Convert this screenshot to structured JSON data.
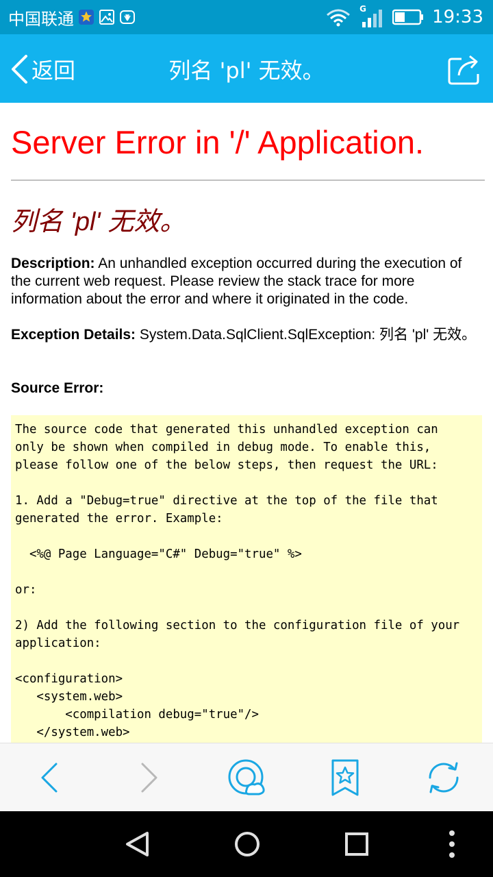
{
  "status_bar": {
    "carrier": "中国联通",
    "network_type": "G",
    "time": "19:33",
    "icons": [
      "star-badge-icon",
      "gallery-icon",
      "huawei-icon",
      "wifi-icon",
      "signal-icon",
      "battery-icon"
    ]
  },
  "app_bar": {
    "back_label": "返回",
    "title": "列名 'pl' 无效。",
    "share_icon": "share-icon"
  },
  "page": {
    "heading": "Server Error in '/' Application.",
    "subheading": "列名 'pl' 无效。",
    "description_label": "Description:",
    "description_text": " An unhandled exception occurred during the execution of the current web request. Please review the stack trace for more information about the error and where it originated in the code.",
    "exception_label": "Exception Details:",
    "exception_text": " System.Data.SqlClient.SqlException: 列名 'pl' 无效。",
    "source_error_label": "Source Error:",
    "source_code": "The source code that generated this unhandled exception can\nonly be shown when compiled in debug mode. To enable this,\nplease follow one of the below steps, then request the URL:\n\n1. Add a \"Debug=true\" directive at the top of the file that\ngenerated the error. Example:\n\n  <%@ Page Language=\"C#\" Debug=\"true\" %>\n\nor:\n\n2) Add the following section to the configuration file of your\napplication:\n\n<configuration>\n   <system.web>\n       <compilation debug=\"true\"/>\n   </system.web>\n</configuration>"
  },
  "browser_bar": {
    "buttons": [
      "back-arrow-icon",
      "forward-arrow-icon",
      "cloud-search-icon",
      "bookmark-star-icon",
      "refresh-icon"
    ]
  },
  "system_nav": {
    "buttons": [
      "nav-back-icon",
      "nav-home-icon",
      "nav-recents-icon",
      "nav-menu-icon"
    ]
  },
  "colors": {
    "status_bar": "#0399c9",
    "app_bar": "#12b3ee",
    "error_heading": "#ff0000",
    "error_subheading": "#800000",
    "code_background": "#ffffcc",
    "browser_icon": "#1aa7e3"
  }
}
